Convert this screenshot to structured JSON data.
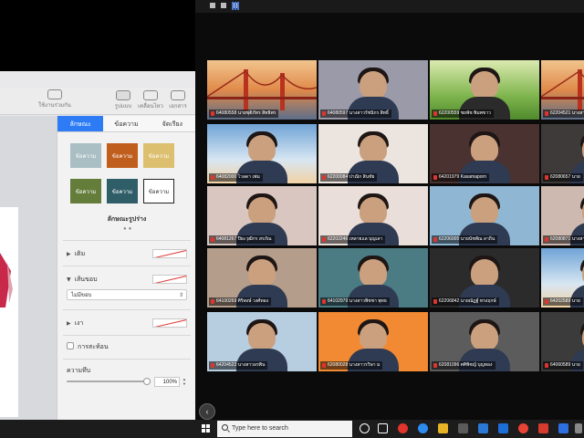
{
  "keynote": {
    "toolbar": {
      "left_item": "ใช้งานร่วมกัน",
      "right_items": [
        "รูปแบบ",
        "เคลื่อนไหว",
        "เอกสาร"
      ]
    },
    "tabs": [
      "ลักษณะ",
      "ข้อความ",
      "จัดเรียง"
    ],
    "active_tab": 0,
    "styles": [
      {
        "label": "ข้อความ",
        "color": "#a9bfc3"
      },
      {
        "label": "ข้อความ",
        "color": "#c05f1d"
      },
      {
        "label": "ข้อความ",
        "color": "#dcc070"
      },
      {
        "label": "ข้อความ",
        "color": "#647d3b"
      },
      {
        "label": "ข้อความ",
        "color": "#2f5d68"
      },
      {
        "label": "ข้อความ",
        "color": "#ffffff"
      }
    ],
    "styles_caption": "ลักษณะรูปร่าง",
    "fill_label": "เติม",
    "border_label": "เส้นขอบ",
    "border_select": "ไม่มีขอบ",
    "shadow_label": "เงา",
    "reflection_label": "การสะท้อน",
    "opacity_label": "ความทึบ",
    "opacity_value": "100%",
    "opacity_fraction": 1.0
  },
  "zoom": {
    "participants": [
      {
        "name": "64080558 นายชุติภัทร สิทธิพร",
        "bg": "#d9a77a",
        "scene": "bridge"
      },
      {
        "name": "64080597 นางสาวรัชนิกร สิทธิ์",
        "bg": "#9b9aa8",
        "scene": "person"
      },
      {
        "name": "62200559 ชยพัช พิมพขาว",
        "bg": "#7eb35a",
        "scene": "grass"
      },
      {
        "name": "62204521 นางสาว",
        "bg": "#c98a55",
        "scene": "bridge"
      },
      {
        "name": "64082000 ไวลดา เพ่ม",
        "bg": "#8fb4d8",
        "scene": "sky"
      },
      {
        "name": "62200084 ปาณิก สินชัย",
        "bg": "#ece4df",
        "scene": "person"
      },
      {
        "name": "64201979 Kasamaporn",
        "bg": "#4a3230",
        "scene": "person"
      },
      {
        "name": "62080657 นาย",
        "bg": "#3d3a39",
        "scene": "person"
      },
      {
        "name": "64081267 ปิยะวุฒิกร สรภัณ",
        "bg": "#d9c6c0",
        "scene": "person"
      },
      {
        "name": "62202246 เหลายแล บุญเลา",
        "bg": "#e9ded9",
        "scene": "person"
      },
      {
        "name": "62206005 นายนัชพัณ ลาถิ่น",
        "bg": "#8fb7d4",
        "scene": "person"
      },
      {
        "name": "62080871 นางสาว",
        "bg": "#cdb9b0",
        "scene": "person"
      },
      {
        "name": "64100269 ศิริพงษ์ วงศ์ทอง",
        "bg": "#b49d8a",
        "scene": "person"
      },
      {
        "name": "64102979 นางสาวพิชชา พุทธ",
        "bg": "#4b7b83",
        "scene": "person"
      },
      {
        "name": "62206842 นายณัฏฐ์ ทรงฤกษ์",
        "bg": "#2b2b2b",
        "scene": "person"
      },
      {
        "name": "64202589 นาย",
        "bg": "#e0b05e",
        "scene": "sky"
      },
      {
        "name": "64204523 นางสาวอรพิน",
        "bg": "#b7cde0",
        "scene": "person"
      },
      {
        "name": "62080028 นางสาวรวิษา ม",
        "bg": "#f18a33",
        "scene": "person"
      },
      {
        "name": "62081096 ศศิพิชญ์ บุญทอง",
        "bg": "#5c5c5c",
        "scene": "person"
      },
      {
        "name": "64060589 นาย",
        "bg": "#3b3b3b",
        "scene": "person"
      }
    ]
  },
  "taskbar": {
    "search_placeholder": "Type here to search"
  }
}
